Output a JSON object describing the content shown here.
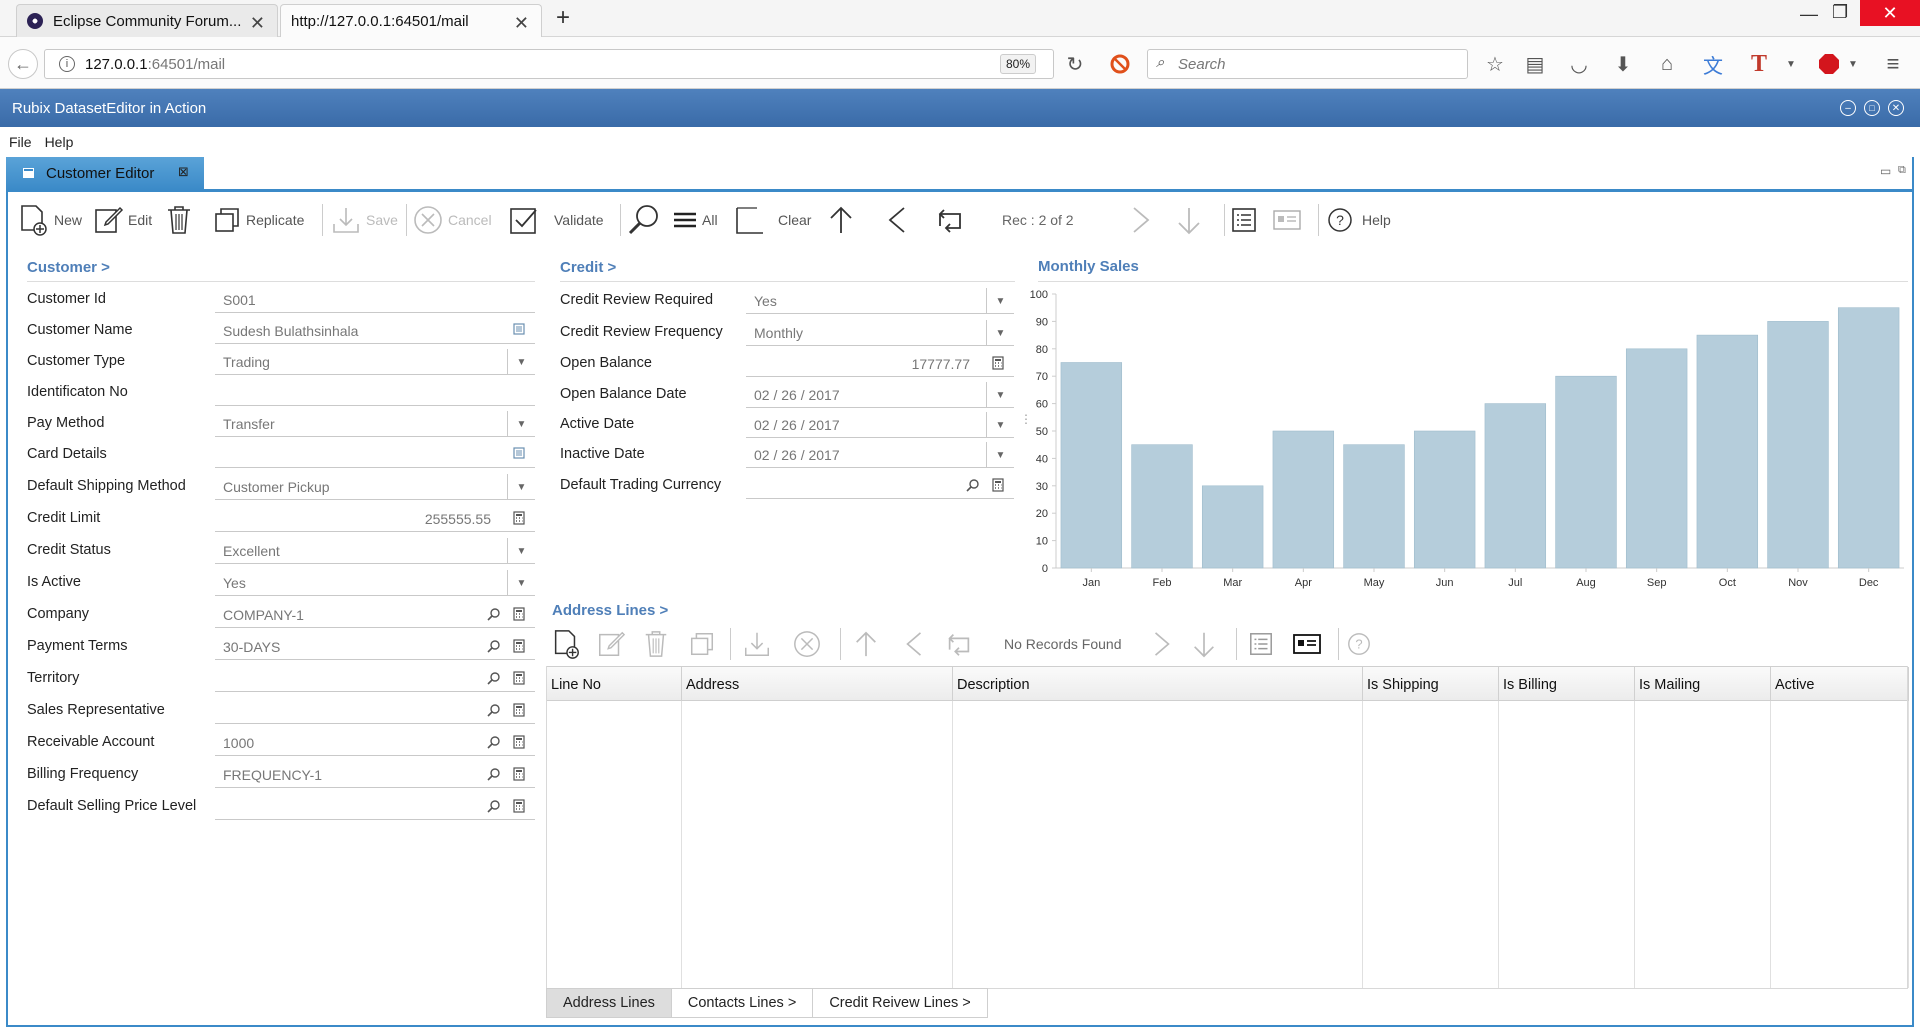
{
  "browser": {
    "tabs": [
      {
        "label": "Eclipse Community Forum..."
      },
      {
        "label": "http://127.0.0.1:64501/mail"
      }
    ],
    "url_host": "127.0.0.1",
    "url_rest": ":64501/mail",
    "zoom": "80%",
    "search_placeholder": "Search",
    "new_tab": "+"
  },
  "app": {
    "title": "Rubix DatasetEditor in Action"
  },
  "menu": {
    "items": [
      "File",
      "Help"
    ]
  },
  "editor": {
    "tab_label": "Customer Editor",
    "toolbar": {
      "new": "New",
      "edit": "Edit",
      "replicate": "Replicate",
      "save": "Save",
      "cancel": "Cancel",
      "validate": "Validate",
      "all": "All",
      "clear": "Clear",
      "record": "Rec : 2 of 2",
      "help": "Help"
    },
    "customer": {
      "section": "Customer >",
      "fields": [
        {
          "label": "Customer Id",
          "value": "S001"
        },
        {
          "label": "Customer Name",
          "value": "Sudesh Bulathsinhala"
        },
        {
          "label": "Customer Type",
          "value": "Trading"
        },
        {
          "label": "Identificaton No",
          "value": ""
        },
        {
          "label": "Pay Method",
          "value": "Transfer"
        },
        {
          "label": "Card Details",
          "value": ""
        },
        {
          "label": "Default Shipping Method",
          "value": "Customer Pickup"
        },
        {
          "label": "Credit Limit",
          "value": "255555.55"
        },
        {
          "label": "Credit Status",
          "value": "Excellent"
        },
        {
          "label": "Is Active",
          "value": "Yes"
        },
        {
          "label": "Company",
          "value": "COMPANY-1"
        },
        {
          "label": "Payment Terms",
          "value": "30-DAYS"
        },
        {
          "label": "Territory",
          "value": ""
        },
        {
          "label": "Sales Representative",
          "value": ""
        },
        {
          "label": "Receivable Account",
          "value": "1000"
        },
        {
          "label": "Billing Frequency",
          "value": "FREQUENCY-1"
        },
        {
          "label": "Default Selling Price Level",
          "value": ""
        }
      ]
    },
    "credit": {
      "section": "Credit >",
      "fields": [
        {
          "label": "Credit Review Required",
          "value": "Yes"
        },
        {
          "label": "Credit Review Frequency",
          "value": "Monthly"
        },
        {
          "label": "Open Balance",
          "value": "17777.77"
        },
        {
          "label": "Open Balance Date",
          "value": "02 / 26 / 2017"
        },
        {
          "label": "Active Date",
          "value": "02 / 26 / 2017"
        },
        {
          "label": "Inactive Date",
          "value": "02 / 26 / 2017"
        },
        {
          "label": "Default Trading Currency",
          "value": ""
        }
      ]
    },
    "address": {
      "section": "Address Lines >",
      "status": "No Records Found",
      "columns": [
        "Line No",
        "Address",
        "Description",
        "Is Shipping",
        "Is Billing",
        "Is Mailing",
        "Active"
      ]
    },
    "bottom_tabs": [
      "Address Lines",
      "Contacts Lines >",
      "Credit Reivew Lines >"
    ],
    "colors": {
      "accent": "#3b8ac8",
      "title_bar": "#4f81bd",
      "section": "#4f7fb8",
      "bar": "#b5cddb"
    }
  },
  "chart_data": {
    "type": "bar",
    "title": "Monthly Sales",
    "categories": [
      "Jan",
      "Feb",
      "Mar",
      "Apr",
      "May",
      "Jun",
      "Jul",
      "Aug",
      "Sep",
      "Oct",
      "Nov",
      "Dec"
    ],
    "values": [
      75,
      45,
      30,
      50,
      45,
      50,
      60,
      70,
      80,
      85,
      90,
      95
    ],
    "ylim": [
      0,
      100
    ],
    "yticks": [
      0,
      10,
      20,
      30,
      40,
      50,
      60,
      70,
      80,
      90,
      100
    ],
    "xlabel": "",
    "ylabel": "",
    "grid": false
  }
}
